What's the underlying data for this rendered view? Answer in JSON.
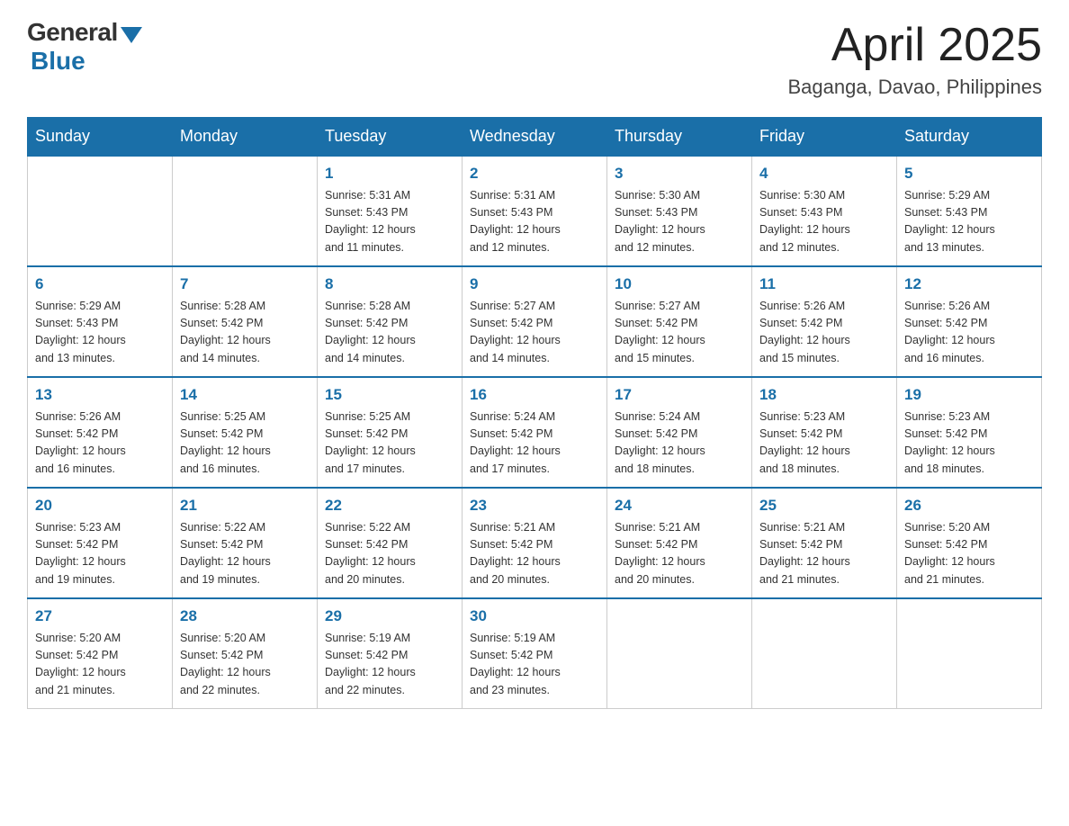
{
  "logo": {
    "general": "General",
    "blue": "Blue"
  },
  "title": "April 2025",
  "location": "Baganga, Davao, Philippines",
  "days_header": [
    "Sunday",
    "Monday",
    "Tuesday",
    "Wednesday",
    "Thursday",
    "Friday",
    "Saturday"
  ],
  "weeks": [
    [
      {
        "day": "",
        "info": ""
      },
      {
        "day": "",
        "info": ""
      },
      {
        "day": "1",
        "info": "Sunrise: 5:31 AM\nSunset: 5:43 PM\nDaylight: 12 hours\nand 11 minutes."
      },
      {
        "day": "2",
        "info": "Sunrise: 5:31 AM\nSunset: 5:43 PM\nDaylight: 12 hours\nand 12 minutes."
      },
      {
        "day": "3",
        "info": "Sunrise: 5:30 AM\nSunset: 5:43 PM\nDaylight: 12 hours\nand 12 minutes."
      },
      {
        "day": "4",
        "info": "Sunrise: 5:30 AM\nSunset: 5:43 PM\nDaylight: 12 hours\nand 12 minutes."
      },
      {
        "day": "5",
        "info": "Sunrise: 5:29 AM\nSunset: 5:43 PM\nDaylight: 12 hours\nand 13 minutes."
      }
    ],
    [
      {
        "day": "6",
        "info": "Sunrise: 5:29 AM\nSunset: 5:43 PM\nDaylight: 12 hours\nand 13 minutes."
      },
      {
        "day": "7",
        "info": "Sunrise: 5:28 AM\nSunset: 5:42 PM\nDaylight: 12 hours\nand 14 minutes."
      },
      {
        "day": "8",
        "info": "Sunrise: 5:28 AM\nSunset: 5:42 PM\nDaylight: 12 hours\nand 14 minutes."
      },
      {
        "day": "9",
        "info": "Sunrise: 5:27 AM\nSunset: 5:42 PM\nDaylight: 12 hours\nand 14 minutes."
      },
      {
        "day": "10",
        "info": "Sunrise: 5:27 AM\nSunset: 5:42 PM\nDaylight: 12 hours\nand 15 minutes."
      },
      {
        "day": "11",
        "info": "Sunrise: 5:26 AM\nSunset: 5:42 PM\nDaylight: 12 hours\nand 15 minutes."
      },
      {
        "day": "12",
        "info": "Sunrise: 5:26 AM\nSunset: 5:42 PM\nDaylight: 12 hours\nand 16 minutes."
      }
    ],
    [
      {
        "day": "13",
        "info": "Sunrise: 5:26 AM\nSunset: 5:42 PM\nDaylight: 12 hours\nand 16 minutes."
      },
      {
        "day": "14",
        "info": "Sunrise: 5:25 AM\nSunset: 5:42 PM\nDaylight: 12 hours\nand 16 minutes."
      },
      {
        "day": "15",
        "info": "Sunrise: 5:25 AM\nSunset: 5:42 PM\nDaylight: 12 hours\nand 17 minutes."
      },
      {
        "day": "16",
        "info": "Sunrise: 5:24 AM\nSunset: 5:42 PM\nDaylight: 12 hours\nand 17 minutes."
      },
      {
        "day": "17",
        "info": "Sunrise: 5:24 AM\nSunset: 5:42 PM\nDaylight: 12 hours\nand 18 minutes."
      },
      {
        "day": "18",
        "info": "Sunrise: 5:23 AM\nSunset: 5:42 PM\nDaylight: 12 hours\nand 18 minutes."
      },
      {
        "day": "19",
        "info": "Sunrise: 5:23 AM\nSunset: 5:42 PM\nDaylight: 12 hours\nand 18 minutes."
      }
    ],
    [
      {
        "day": "20",
        "info": "Sunrise: 5:23 AM\nSunset: 5:42 PM\nDaylight: 12 hours\nand 19 minutes."
      },
      {
        "day": "21",
        "info": "Sunrise: 5:22 AM\nSunset: 5:42 PM\nDaylight: 12 hours\nand 19 minutes."
      },
      {
        "day": "22",
        "info": "Sunrise: 5:22 AM\nSunset: 5:42 PM\nDaylight: 12 hours\nand 20 minutes."
      },
      {
        "day": "23",
        "info": "Sunrise: 5:21 AM\nSunset: 5:42 PM\nDaylight: 12 hours\nand 20 minutes."
      },
      {
        "day": "24",
        "info": "Sunrise: 5:21 AM\nSunset: 5:42 PM\nDaylight: 12 hours\nand 20 minutes."
      },
      {
        "day": "25",
        "info": "Sunrise: 5:21 AM\nSunset: 5:42 PM\nDaylight: 12 hours\nand 21 minutes."
      },
      {
        "day": "26",
        "info": "Sunrise: 5:20 AM\nSunset: 5:42 PM\nDaylight: 12 hours\nand 21 minutes."
      }
    ],
    [
      {
        "day": "27",
        "info": "Sunrise: 5:20 AM\nSunset: 5:42 PM\nDaylight: 12 hours\nand 21 minutes."
      },
      {
        "day": "28",
        "info": "Sunrise: 5:20 AM\nSunset: 5:42 PM\nDaylight: 12 hours\nand 22 minutes."
      },
      {
        "day": "29",
        "info": "Sunrise: 5:19 AM\nSunset: 5:42 PM\nDaylight: 12 hours\nand 22 minutes."
      },
      {
        "day": "30",
        "info": "Sunrise: 5:19 AM\nSunset: 5:42 PM\nDaylight: 12 hours\nand 23 minutes."
      },
      {
        "day": "",
        "info": ""
      },
      {
        "day": "",
        "info": ""
      },
      {
        "day": "",
        "info": ""
      }
    ]
  ]
}
